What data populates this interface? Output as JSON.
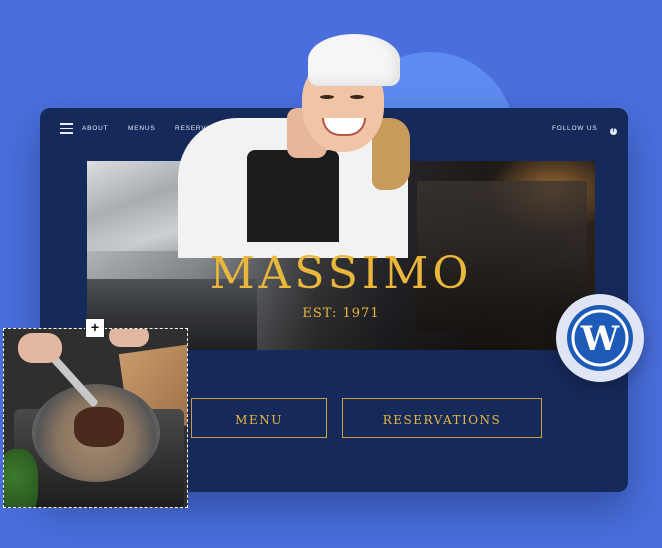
{
  "nav": {
    "links": [
      "ABOUT",
      "MENUS",
      "RESERVATION"
    ],
    "follow_label": "FOLLOW US",
    "social_icon": "facebook-icon"
  },
  "hero": {
    "title": "MASSIMO",
    "subtitle": "EST: 1971"
  },
  "buttons": {
    "menu": "MENU",
    "reservations": "RESERVATIONS"
  },
  "overlay": {
    "add_symbol": "+"
  },
  "badge": {
    "icon": "wordpress-logo"
  },
  "colors": {
    "background": "#4a6fdc",
    "site_bg": "#16295b",
    "accent_gold": "#e9b73c"
  }
}
